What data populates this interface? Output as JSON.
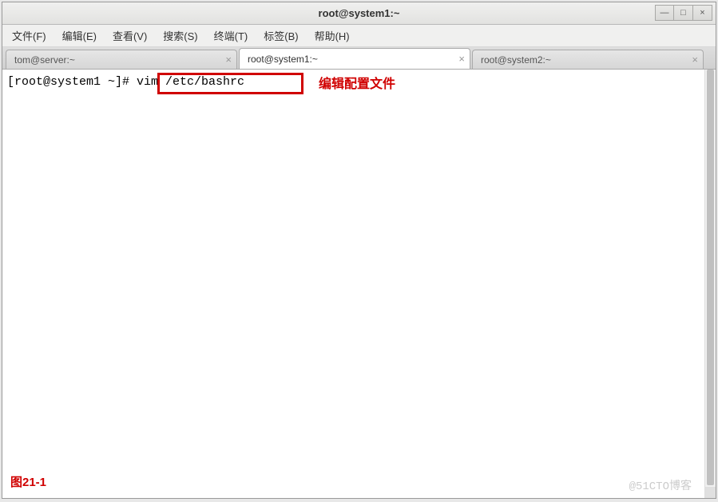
{
  "titlebar": {
    "title": "root@system1:~"
  },
  "window_controls": {
    "minimize": "—",
    "maximize": "□",
    "close": "×"
  },
  "menu": [
    "文件(F)",
    "编辑(E)",
    "查看(V)",
    "搜索(S)",
    "终端(T)",
    "标签(B)",
    "帮助(H)"
  ],
  "tabs": [
    {
      "label": "tom@server:~",
      "active": false
    },
    {
      "label": "root@system1:~",
      "active": true
    },
    {
      "label": "root@system2:~",
      "active": false
    }
  ],
  "terminal": {
    "prompt": "[root@system1 ~]# ",
    "command": "vim /etc/bashrc"
  },
  "annotation": "编辑配置文件",
  "figure_label": "图21-1",
  "watermark": "@51CTO博客"
}
